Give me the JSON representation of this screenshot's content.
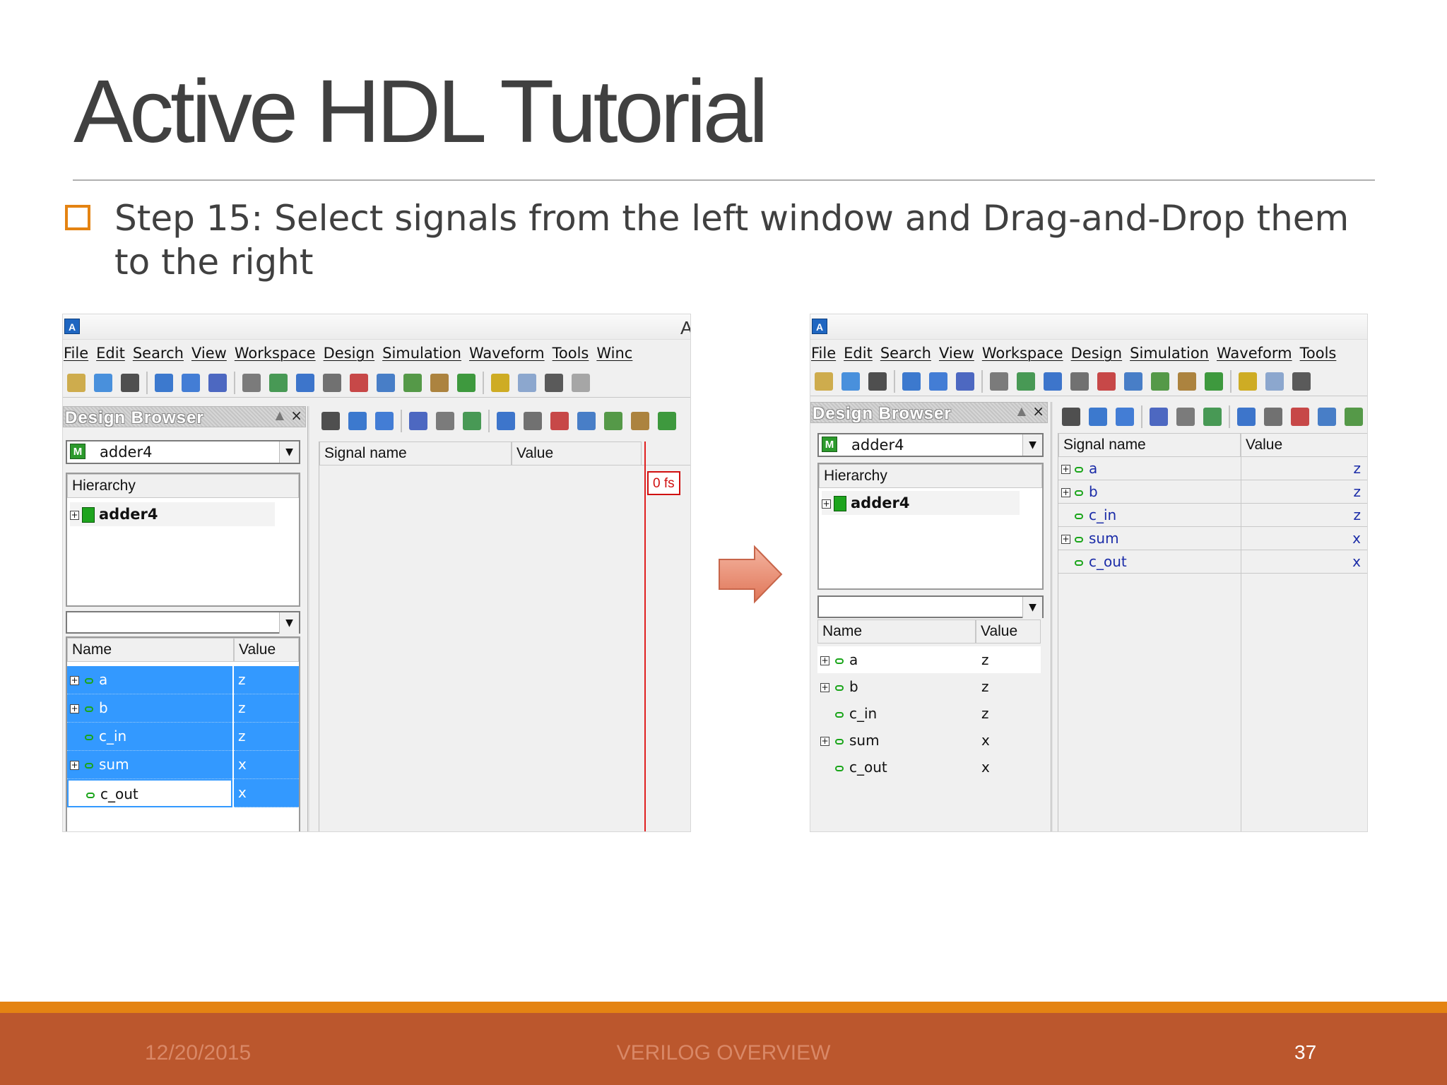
{
  "slide": {
    "title": "Active HDL Tutorial",
    "bullet": "Step 15: Select signals from the left window and Drag-and-Drop them to the right"
  },
  "footer": {
    "date": "12/20/2015",
    "topic": "VERILOG OVERVIEW",
    "page": "37"
  },
  "left_screen": {
    "app_icon": "A",
    "title_partial": "A",
    "menu": [
      "File",
      "Edit",
      "Search",
      "View",
      "Workspace",
      "Design",
      "Simulation",
      "Waveform",
      "Tools",
      "Winc"
    ],
    "design_browser": {
      "title": "Design Browser",
      "combo_value": "adder4",
      "hierarchy_header": "Hierarchy",
      "hierarchy_item": "adder4",
      "name_header": "Name",
      "value_header": "Value",
      "signals": [
        {
          "name": "a",
          "value": "z",
          "expandable": true
        },
        {
          "name": "b",
          "value": "z",
          "expandable": true
        },
        {
          "name": "c_in",
          "value": "z",
          "expandable": false
        },
        {
          "name": "sum",
          "value": "x",
          "expandable": true
        },
        {
          "name": "c_out",
          "value": "x",
          "expandable": false
        }
      ]
    },
    "waveform": {
      "signal_header": "Signal name",
      "value_header": "Value",
      "time_marker": "0 fs"
    }
  },
  "right_screen": {
    "app_icon": "A",
    "menu": [
      "File",
      "Edit",
      "Search",
      "View",
      "Workspace",
      "Design",
      "Simulation",
      "Waveform",
      "Tools"
    ],
    "design_browser": {
      "title": "Design Browser",
      "combo_value": "adder4",
      "hierarchy_header": "Hierarchy",
      "hierarchy_item": "adder4",
      "name_header": "Name",
      "value_header": "Value",
      "signals": [
        {
          "name": "a",
          "value": "z",
          "expandable": true
        },
        {
          "name": "b",
          "value": "z",
          "expandable": true
        },
        {
          "name": "c_in",
          "value": "z",
          "expandable": false
        },
        {
          "name": "sum",
          "value": "x",
          "expandable": true
        },
        {
          "name": "c_out",
          "value": "x",
          "expandable": false
        }
      ]
    },
    "waveform": {
      "signal_header": "Signal name",
      "value_header": "Value",
      "signals": [
        {
          "name": "a",
          "value": "z",
          "expandable": true
        },
        {
          "name": "b",
          "value": "z",
          "expandable": true
        },
        {
          "name": "c_in",
          "value": "z",
          "expandable": false
        },
        {
          "name": "sum",
          "value": "x",
          "expandable": true
        },
        {
          "name": "c_out",
          "value": "x",
          "expandable": false
        }
      ]
    }
  },
  "colors": {
    "accent_orange": "#e48312",
    "footer_bar": "#bb572d",
    "selection_blue": "#3399ff",
    "arrow_fill": "#e8836a"
  }
}
